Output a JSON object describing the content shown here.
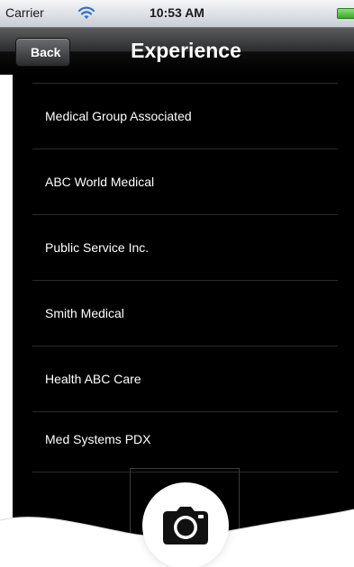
{
  "status_bar": {
    "carrier": "Carrier",
    "time": "10:53 AM",
    "wifi_icon": "wifi-icon",
    "battery_icon": "battery-icon"
  },
  "nav_bar": {
    "back_label": "Back",
    "title": "Experience"
  },
  "list": {
    "items": [
      {
        "label": "Medical Group Associated"
      },
      {
        "label": "ABC World Medical"
      },
      {
        "label": "Public Service Inc."
      },
      {
        "label": "Smith Medical"
      },
      {
        "label": "Health ABC Care"
      },
      {
        "label": "Med Systems PDX"
      }
    ]
  },
  "camera": {
    "icon": "camera-icon"
  },
  "colors": {
    "list_background": "#000000",
    "list_text": "#ffffff",
    "separator": "#2b2b2b",
    "nav_background": "#2b2c2d",
    "battery": "#3aa82a"
  }
}
